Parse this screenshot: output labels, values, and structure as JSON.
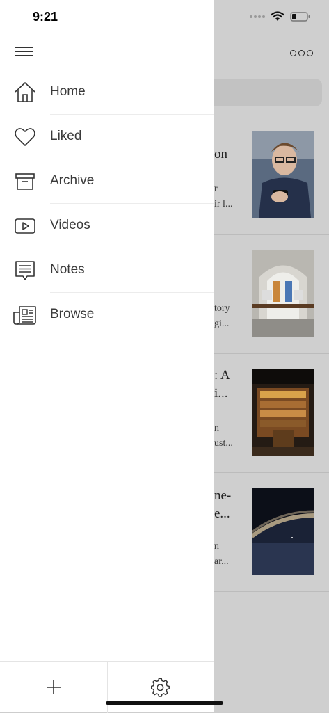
{
  "status_bar": {
    "time": "9:21"
  },
  "drawer": {
    "items": [
      {
        "label": "Home",
        "icon": "home-icon"
      },
      {
        "label": "Liked",
        "icon": "heart-icon"
      },
      {
        "label": "Archive",
        "icon": "archive-icon"
      },
      {
        "label": "Videos",
        "icon": "video-icon"
      },
      {
        "label": "Notes",
        "icon": "notes-icon"
      },
      {
        "label": "Browse",
        "icon": "newspaper-icon"
      }
    ],
    "bottom": {
      "add_icon": "plus-icon",
      "settings_icon": "gear-icon"
    }
  },
  "background_feed": {
    "cards": [
      {
        "title_lines": [
          "on"
        ],
        "sub_lines": [
          "r",
          "ir l..."
        ]
      },
      {
        "title_lines": [],
        "sub_lines": [
          "tory",
          "gi..."
        ]
      },
      {
        "title_lines": [
          ": A",
          "i..."
        ],
        "sub_lines": [
          "n",
          "ust..."
        ]
      },
      {
        "title_lines": [
          "ne-",
          "e..."
        ],
        "sub_lines": [
          "n",
          "ar..."
        ]
      }
    ]
  },
  "colors": {
    "drawer_bg": "#ffffff",
    "overlay": "#cfcfcf",
    "text": "#3a3a3a"
  }
}
